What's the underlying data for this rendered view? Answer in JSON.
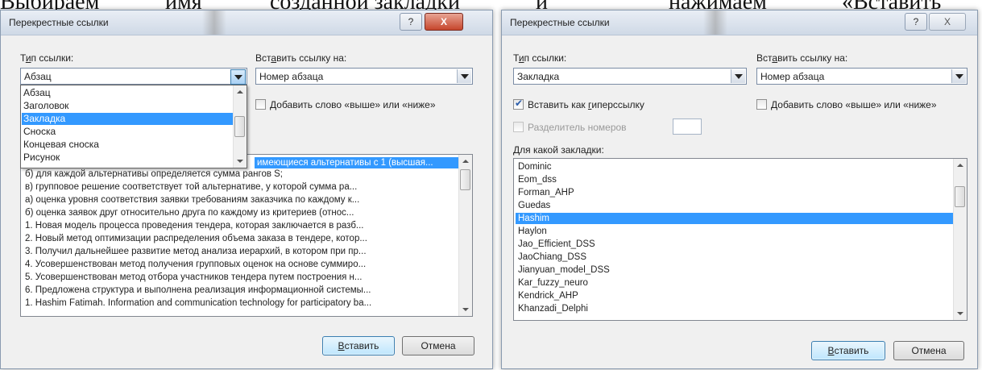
{
  "top_text": {
    "w1": "Выбираем",
    "w2": "имя",
    "w3": "созданной закладки",
    "w4": "и",
    "w5": "нажимаем",
    "w6": "«Вставить"
  },
  "dialog_left": {
    "title": "Перекрестные ссылки",
    "help_label": "?",
    "close_label": "X",
    "ref_type_label_a": "Т",
    "ref_type_label_u": "и",
    "ref_type_label_b": "п ссылки:",
    "ref_type_value": "Абзац",
    "insert_ref_label_a": "Вст",
    "insert_ref_label_u": "а",
    "insert_ref_label_b": "вить ссылку на:",
    "insert_ref_value": "Номер абзаца",
    "add_word_label_u": "Д",
    "add_word_label_b": "обавить слово «выше» или «ниже»",
    "dropdown_items": [
      "Абзац",
      "Заголовок",
      "Закладка",
      "Сноска",
      "Концевая сноска",
      "Рисунок"
    ],
    "dropdown_selected_index": 2,
    "list_first_row": "имеющиеся альтернативы с 1 (высшая...",
    "list_rows": [
      "б)  для каждой альтернативы определяется сумма рангов S;",
      "в)  групповое решение соответствует той альтернативе, у которой сумма ра...",
      "а)  оценка уровня соответствия заявки требованиям заказчика по каждому к...",
      "б)  оценка заявок друг относительно друга по каждому из критериев (относ...",
      "1. Новая модель процесса проведения тендера, которая заключается в разб...",
      "2. Новый метод оптимизации распределения объема заказа в тендере, котор...",
      "3. Получил дальнейшее развитие метод анализа иерархий, в котором при пр...",
      "4. Усовершенствован метод получения групповых оценок на основе суммиро...",
      "5. Усовершенствован метод отбора участников тендера путем построения н...",
      "6. Предложена структура и выполнена реализация информационной системы...",
      "1. Hashim Fatimah. Information and communication technology for participatory ba..."
    ],
    "insert_button_u": "В",
    "insert_button_b": "ставить",
    "cancel_button": "Отмена"
  },
  "dialog_right": {
    "title": "Перекрестные ссылки",
    "help_label": "?",
    "close_label": "X",
    "ref_type_label_a": "Т",
    "ref_type_label_u": "и",
    "ref_type_label_b": "п ссылки:",
    "ref_type_value": "Закладка",
    "insert_ref_label_a": "Вст",
    "insert_ref_label_u": "а",
    "insert_ref_label_b": "вить ссылку на:",
    "insert_ref_value": "Номер абзаца",
    "hyperlink_label_a": "Вставить как ",
    "hyperlink_label_u": "г",
    "hyperlink_label_b": "иперссылку",
    "add_word_label_u": "Д",
    "add_word_label_b": "обавить слово «выше» или «ниже»",
    "separator_label": "Разделитель номеров",
    "bookmark_label_u": "Д",
    "bookmark_label_b": "ля какой закладки:",
    "bookmarks": [
      "Dominic",
      "Eom_dss",
      "Forman_AHP",
      "Guedas",
      "Hashim",
      "Haylon",
      "Jao_Efficient_DSS",
      "JaoChiang_DSS",
      "Jianyuan_model_DSS",
      "Kar_fuzzy_neuro",
      "Kendrick_AHP",
      "Khanzadi_Delphi"
    ],
    "selected_bookmark_index": 4,
    "insert_button_u": "В",
    "insert_button_b": "ставить",
    "cancel_button": "Отмена"
  }
}
